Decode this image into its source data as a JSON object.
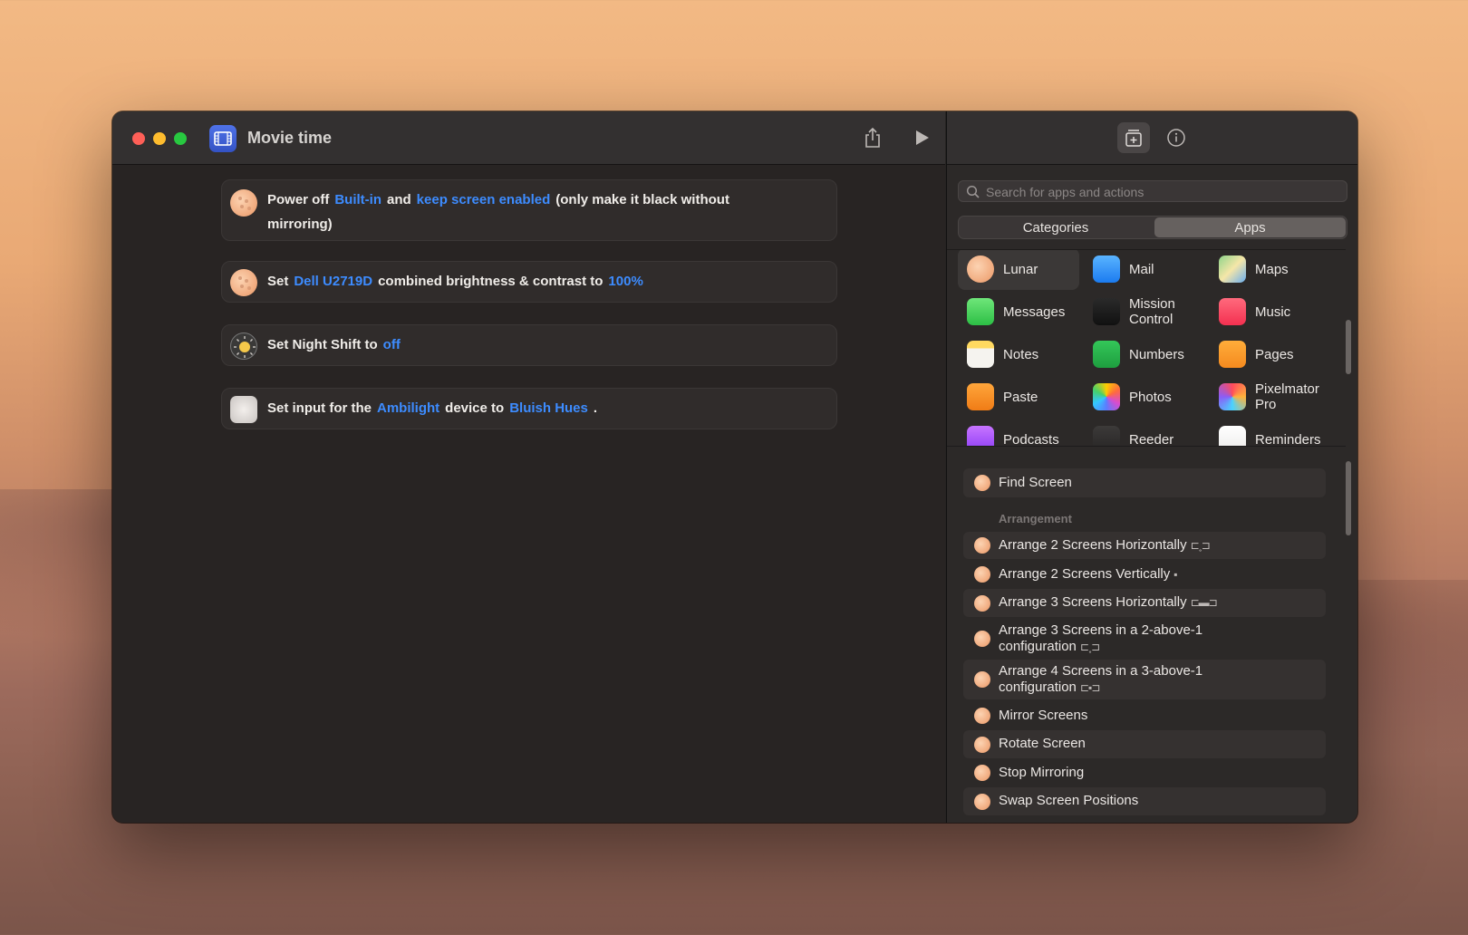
{
  "window": {
    "title": "Movie time"
  },
  "actions": [
    {
      "parts": [
        {
          "t": "Power off",
          "tok": false
        },
        {
          "t": "Built-in",
          "tok": true
        },
        {
          "t": "and",
          "tok": false
        },
        {
          "t": "keep screen enabled",
          "tok": true
        },
        {
          "t": "(only make it black without mirroring)",
          "tok": false
        }
      ]
    },
    {
      "parts": [
        {
          "t": "Set",
          "tok": false
        },
        {
          "t": "Dell U2719D",
          "tok": true
        },
        {
          "t": "combined brightness & contrast to",
          "tok": false
        },
        {
          "t": "100%",
          "tok": true
        }
      ]
    },
    {
      "parts": [
        {
          "t": "Set Night Shift to",
          "tok": false
        },
        {
          "t": "off",
          "tok": true
        }
      ]
    },
    {
      "parts": [
        {
          "t": "Set input for the",
          "tok": false
        },
        {
          "t": "Ambilight",
          "tok": true
        },
        {
          "t": "device to",
          "tok": false
        },
        {
          "t": "Bluish Hues",
          "tok": true
        },
        {
          "t": ".",
          "tok": false
        }
      ]
    }
  ],
  "library": {
    "search_placeholder": "Search for apps and actions",
    "segments": {
      "categories": "Categories",
      "apps": "Apps",
      "selected": "Apps"
    },
    "apps": [
      {
        "name": "Lunar",
        "icon": "lunar-icon",
        "selected": true
      },
      {
        "name": "Mail",
        "icon": "mail-icon"
      },
      {
        "name": "Maps",
        "icon": "maps-icon"
      },
      {
        "name": "Messages",
        "icon": "messages-icon"
      },
      {
        "name": "Mission Control",
        "icon": "mission-control-icon"
      },
      {
        "name": "Music",
        "icon": "music-icon"
      },
      {
        "name": "Notes",
        "icon": "notes-icon"
      },
      {
        "name": "Numbers",
        "icon": "numbers-icon"
      },
      {
        "name": "Pages",
        "icon": "pages-icon"
      },
      {
        "name": "Paste",
        "icon": "paste-icon"
      },
      {
        "name": "Photos",
        "icon": "photos-icon"
      },
      {
        "name": "Pixelmator Pro",
        "icon": "pixelmator-icon"
      },
      {
        "name": "Podcasts",
        "icon": "podcasts-icon"
      },
      {
        "name": "Reeder",
        "icon": "reeder-icon"
      },
      {
        "name": "Reminders",
        "icon": "reminders-icon"
      }
    ],
    "top_action": "Find Screen",
    "section": "Arrangement",
    "lunar_actions": [
      {
        "label": "Arrange 2 Screens Horizontally",
        "glyph": "⊏˳⊐"
      },
      {
        "label": "Arrange 2 Screens Vertically",
        "glyph": "▪"
      },
      {
        "label": "Arrange 3 Screens Horizontally",
        "glyph": "⊏▬⊐"
      },
      {
        "label": "Arrange 3 Screens in a 2-above-1 configuration",
        "glyph": "⊏˳⊐"
      },
      {
        "label": "Arrange 4 Screens in a 3-above-1 configuration",
        "glyph": "⊏▪⊐"
      },
      {
        "label": "Mirror Screens",
        "glyph": ""
      },
      {
        "label": "Rotate Screen",
        "glyph": ""
      },
      {
        "label": "Stop Mirroring",
        "glyph": ""
      },
      {
        "label": "Swap Screen Positions",
        "glyph": ""
      }
    ]
  },
  "colors": {
    "accent": "#3d8cff",
    "window_bg": "#282423",
    "lunar": "#f0a97c"
  }
}
